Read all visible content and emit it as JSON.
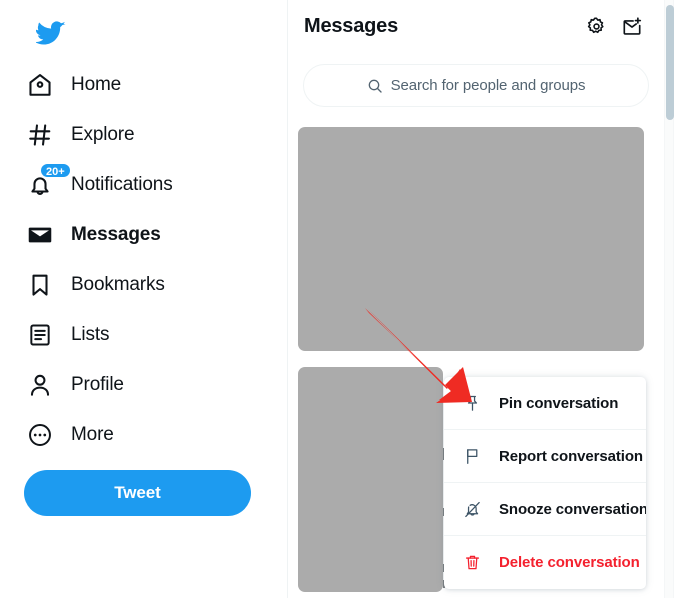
{
  "app": {
    "logo_icon": "twitter-bird-icon",
    "accent_color": "#1d9bf0",
    "danger_color": "#f4212e",
    "text_color": "#0f1419",
    "muted_text_color": "#536471",
    "redaction_color": "#ababab"
  },
  "sidebar": {
    "items": [
      {
        "label": "Home",
        "icon": "home-icon",
        "active": false,
        "badge": null
      },
      {
        "label": "Explore",
        "icon": "hashtag-icon",
        "active": false,
        "badge": null
      },
      {
        "label": "Notifications",
        "icon": "bell-icon",
        "active": false,
        "badge": "20+"
      },
      {
        "label": "Messages",
        "icon": "envelope-icon",
        "active": true,
        "badge": null
      },
      {
        "label": "Bookmarks",
        "icon": "bookmark-icon",
        "active": false,
        "badge": null
      },
      {
        "label": "Lists",
        "icon": "list-icon",
        "active": false,
        "badge": null
      },
      {
        "label": "Profile",
        "icon": "person-icon",
        "active": false,
        "badge": null
      },
      {
        "label": "More",
        "icon": "more-circle-icon",
        "active": false,
        "badge": null
      }
    ],
    "tweet_button": "Tweet"
  },
  "header": {
    "title": "Messages",
    "settings_icon": "gear-icon",
    "new_message_icon": "new-message-icon"
  },
  "search": {
    "icon": "search-icon",
    "placeholder": "Search for people and groups",
    "value": ""
  },
  "conversations": {
    "redacted_items": [
      {
        "name": "conversation-preview-1"
      },
      {
        "name": "conversation-preview-2"
      }
    ]
  },
  "context_menu": {
    "items": [
      {
        "label": "Pin conversation",
        "icon": "pin-icon",
        "danger": false
      },
      {
        "label": "Report conversation",
        "icon": "flag-icon",
        "danger": false
      },
      {
        "label": "Snooze conversation",
        "icon": "bell-muted-icon",
        "danger": false
      },
      {
        "label": "Delete conversation",
        "icon": "trash-icon",
        "danger": true
      }
    ]
  },
  "annotation": {
    "arrow_color": "#ef2b23",
    "points_to": "Pin conversation"
  },
  "scrollbar": {
    "thumb_color": "#bdcdd6"
  }
}
